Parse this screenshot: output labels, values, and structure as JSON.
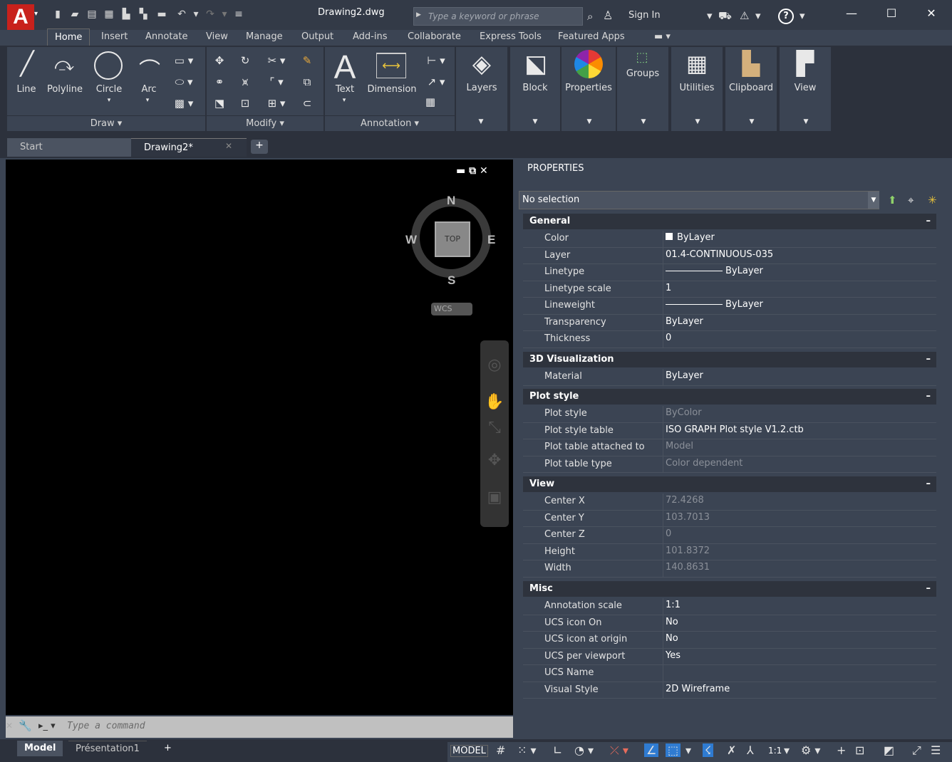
{
  "app": {
    "doc_title": "Drawing2.dwg",
    "logo": "A"
  },
  "search": {
    "placeholder": "Type a keyword or phrase"
  },
  "account": {
    "signin": "Sign In"
  },
  "tabs": [
    "Home",
    "Insert",
    "Annotate",
    "View",
    "Manage",
    "Output",
    "Add-ins",
    "Collaborate",
    "Express Tools",
    "Featured Apps"
  ],
  "ribbon": {
    "draw": {
      "line": "Line",
      "polyline": "Polyline",
      "circle": "Circle",
      "arc": "Arc",
      "panel": "Draw ▾"
    },
    "modify": {
      "panel": "Modify ▾"
    },
    "annotation": {
      "text": "Text",
      "dimension": "Dimension",
      "panel": "Annotation ▾"
    },
    "layers": "Layers",
    "block": "Block",
    "properties": "Properties",
    "groups": "Groups",
    "utilities": "Utilities",
    "clipboard": "Clipboard",
    "view": "View"
  },
  "doctabs": {
    "start": "Start",
    "drawing": "Drawing2*"
  },
  "viewcube": {
    "top": "TOP",
    "n": "N",
    "s": "S",
    "e": "E",
    "w": "W",
    "wcs": "WCS"
  },
  "command": {
    "placeholder": "Type a command"
  },
  "layouts": {
    "model": "Model",
    "presentation": "Présentation1"
  },
  "status": {
    "model": "MODEL",
    "scale": "1:1"
  },
  "properties": {
    "title": "PROPERTIES",
    "selection": "No selection",
    "sections": [
      {
        "name": "General",
        "rows": [
          {
            "label": "Color",
            "value": "ByLayer"
          },
          {
            "label": "Layer",
            "value": "01.4-CONTINUOUS-035"
          },
          {
            "label": "Linetype",
            "value": "ByLayer"
          },
          {
            "label": "Linetype scale",
            "value": "1"
          },
          {
            "label": "Lineweight",
            "value": "ByLayer"
          },
          {
            "label": "Transparency",
            "value": "ByLayer"
          },
          {
            "label": "Thickness",
            "value": "0"
          }
        ]
      },
      {
        "name": "3D Visualization",
        "rows": [
          {
            "label": "Material",
            "value": "ByLayer"
          }
        ]
      },
      {
        "name": "Plot style",
        "rows": [
          {
            "label": "Plot style",
            "value": "ByColor"
          },
          {
            "label": "Plot style table",
            "value": "ISO GRAPH Plot style V1.2.ctb"
          },
          {
            "label": "Plot table attached to",
            "value": "Model"
          },
          {
            "label": "Plot table type",
            "value": "Color dependent"
          }
        ]
      },
      {
        "name": "View",
        "rows": [
          {
            "label": "Center X",
            "value": "72.4268"
          },
          {
            "label": "Center Y",
            "value": "103.7013"
          },
          {
            "label": "Center Z",
            "value": "0"
          },
          {
            "label": "Height",
            "value": "101.8372"
          },
          {
            "label": "Width",
            "value": "140.8631"
          }
        ]
      },
      {
        "name": "Misc",
        "rows": [
          {
            "label": "Annotation scale",
            "value": "1:1"
          },
          {
            "label": "UCS icon On",
            "value": "No"
          },
          {
            "label": "UCS icon at origin",
            "value": "No"
          },
          {
            "label": "UCS per viewport",
            "value": "Yes"
          },
          {
            "label": "UCS Name",
            "value": ""
          },
          {
            "label": "Visual Style",
            "value": "2D Wireframe"
          }
        ]
      }
    ]
  }
}
